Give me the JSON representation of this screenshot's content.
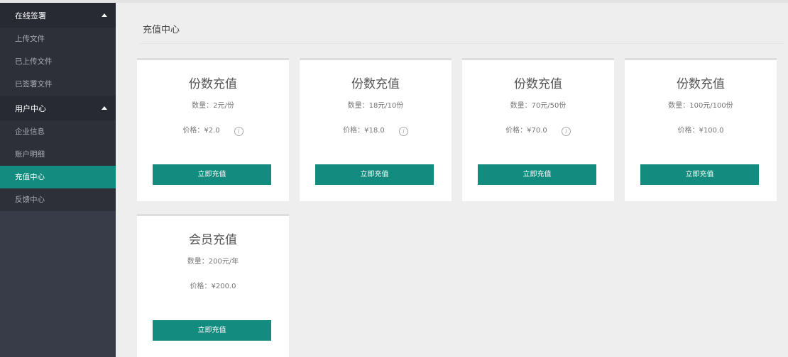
{
  "sidebar": {
    "groups": [
      {
        "title": "在线签署",
        "items": [
          {
            "label": "上传文件"
          },
          {
            "label": "已上传文件"
          },
          {
            "label": "已签署文件"
          }
        ]
      },
      {
        "title": "用户中心",
        "items": [
          {
            "label": "企业信息"
          },
          {
            "label": "账户明细"
          },
          {
            "label": "充值中心",
            "active": true
          },
          {
            "label": "反馈中心"
          }
        ]
      }
    ]
  },
  "main": {
    "title": "充值中心",
    "cards": [
      {
        "title": "份数充值",
        "qty": "数量：2元/份",
        "price": "价格：¥2.0",
        "has_info": true,
        "button": "立即充值"
      },
      {
        "title": "份数充值",
        "qty": "数量：18元/10份",
        "price": "价格：¥18.0",
        "has_info": true,
        "button": "立即充值"
      },
      {
        "title": "份数充值",
        "qty": "数量：70元/50份",
        "price": "价格：¥70.0",
        "has_info": true,
        "button": "立即充值"
      },
      {
        "title": "份数充值",
        "qty": "数量：100元/100份",
        "price": "价格：¥100.0",
        "has_info": false,
        "button": "立即充值"
      },
      {
        "title": "会员充值",
        "qty": "数量：200元/年",
        "price": "价格：¥200.0",
        "has_info": false,
        "button": "立即充值"
      }
    ]
  },
  "icons": {
    "group_toggle": "caret-up-icon",
    "info": "info-icon"
  },
  "colors": {
    "sidebar_bg": "#383c48",
    "group_header_bg": "#272a33",
    "accent": "#138b7e",
    "page_bg": "#eeeeee"
  }
}
